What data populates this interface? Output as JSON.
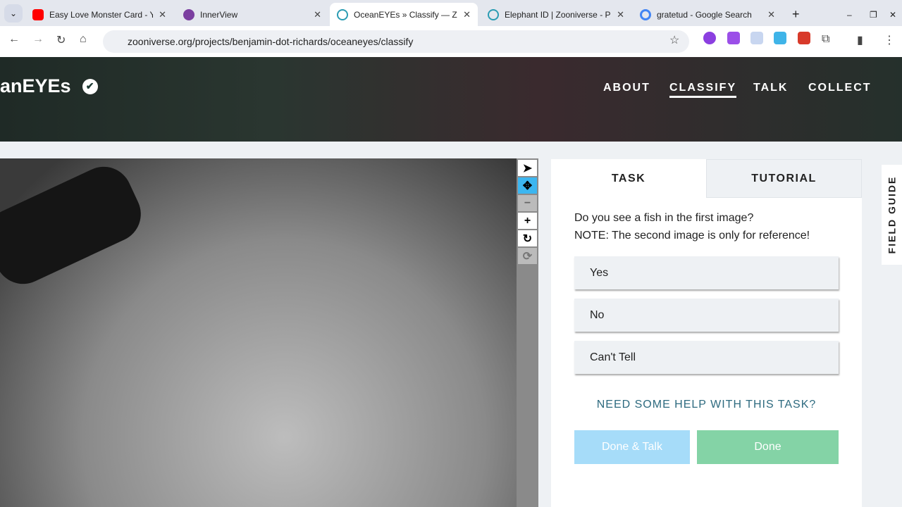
{
  "browser": {
    "tabs": [
      {
        "title": "Easy Love Monster Card - You",
        "color": "#ff0000"
      },
      {
        "title": "InnerView",
        "color": "#7b3fa0"
      },
      {
        "title": "OceanEYEs » Classify — Zoon",
        "color": "#2b9cb3"
      },
      {
        "title": "Elephant ID | Zooniverse - Pec",
        "color": "#2b9cb3"
      },
      {
        "title": "gratetud - Google Search",
        "color": "#4285f4"
      }
    ],
    "url": "zooniverse.org/projects/benjamin-dot-richards/oceaneyes/classify"
  },
  "project": {
    "name": "anEYEs",
    "nav": [
      "ABOUT",
      "CLASSIFY",
      "TALK",
      "COLLECT"
    ]
  },
  "panel": {
    "tabs": [
      "TASK",
      "TUTORIAL"
    ],
    "question": "Do you see a fish in the first image?",
    "note": "NOTE: The second image is only for reference!",
    "answers": [
      "Yes",
      "No",
      "Can't Tell"
    ],
    "help": "NEED SOME HELP WITH THIS TASK?",
    "done_talk": "Done & Talk",
    "done": "Done"
  },
  "field_guide": "FIELD GUIDE",
  "colors": {
    "done_talk": "#a6dcf9",
    "done": "#84d3a6",
    "active_tool": "#3cb6f0"
  }
}
